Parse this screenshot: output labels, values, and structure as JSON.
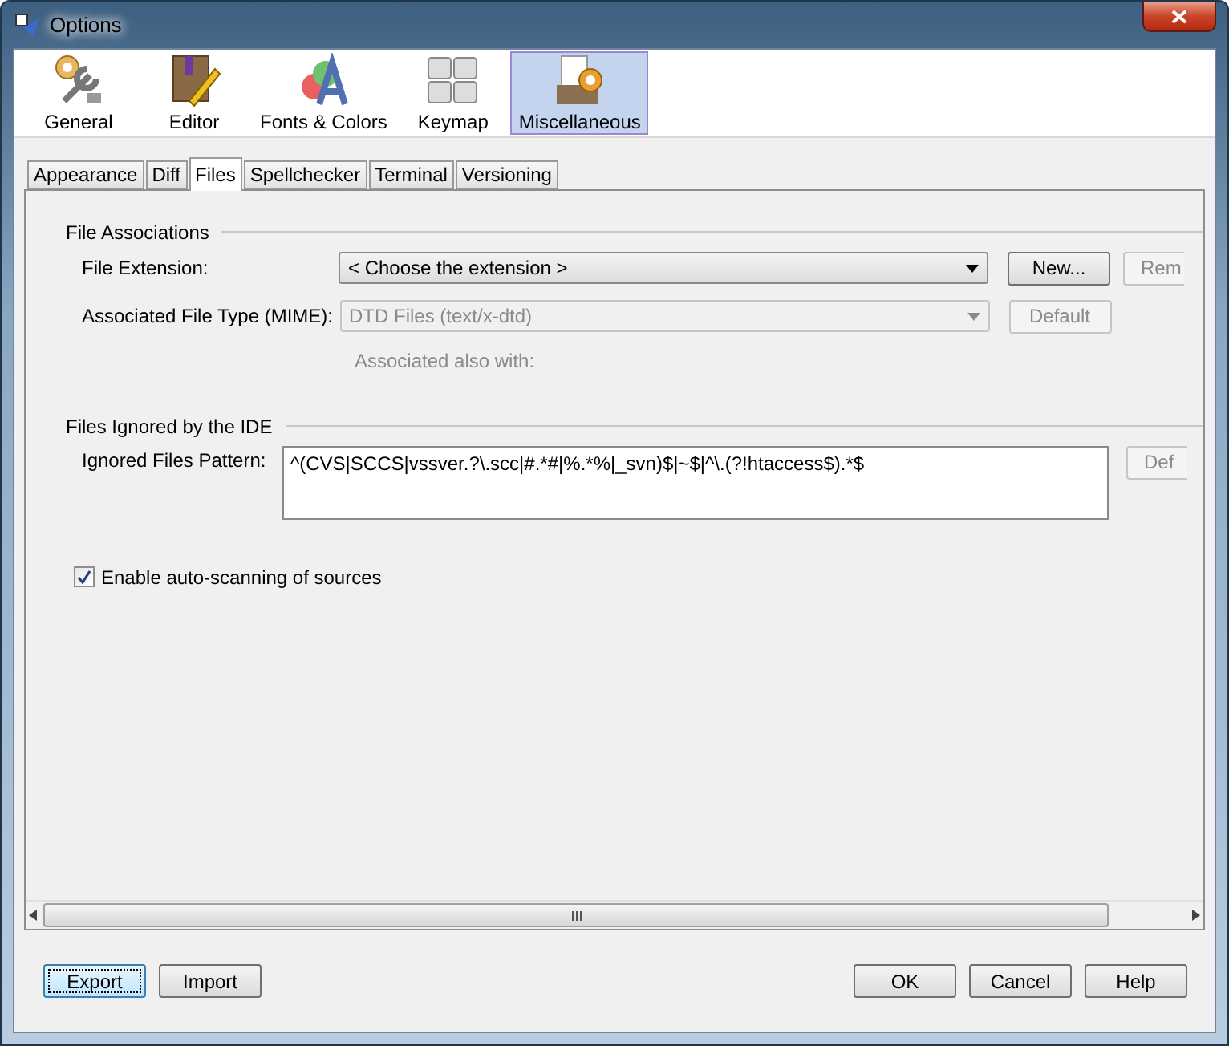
{
  "window": {
    "title": "Options"
  },
  "categories": [
    {
      "label": "General",
      "selected": false
    },
    {
      "label": "Editor",
      "selected": false
    },
    {
      "label": "Fonts & Colors",
      "selected": false
    },
    {
      "label": "Keymap",
      "selected": false
    },
    {
      "label": "Miscellaneous",
      "selected": true
    }
  ],
  "tabs": [
    {
      "label": "Appearance",
      "selected": false
    },
    {
      "label": "Diff",
      "selected": false
    },
    {
      "label": "Files",
      "selected": true
    },
    {
      "label": "Spellchecker",
      "selected": false
    },
    {
      "label": "Terminal",
      "selected": false
    },
    {
      "label": "Versioning",
      "selected": false
    }
  ],
  "file_associations": {
    "heading": "File Associations",
    "file_extension": {
      "label": "File Extension:",
      "value": "< Choose the extension >",
      "disabled": false
    },
    "new_button": {
      "label": "New...",
      "disabled": false
    },
    "remove_button": {
      "label": "Rem",
      "disabled": true
    },
    "mime": {
      "label": "Associated File Type (MIME):",
      "value": "DTD Files (text/x-dtd)",
      "disabled": true
    },
    "default_button": {
      "label": "Default",
      "disabled": true
    },
    "also_with": "Associated also with:"
  },
  "files_ignored": {
    "heading": "Files Ignored by the IDE",
    "label": "Ignored Files Pattern:",
    "value": "^(CVS|SCCS|vssver.?\\.scc|#.*#|%.*%|_svn)$|~$|^\\.(?!htaccess$).*$",
    "default_button": {
      "label": "Def",
      "disabled": true
    }
  },
  "auto_scan": {
    "label": "Enable auto-scanning of sources",
    "checked": true
  },
  "left_buttons": [
    {
      "label": "Export",
      "focused": true
    },
    {
      "label": "Import",
      "focused": false
    }
  ],
  "right_buttons": [
    {
      "label": "OK",
      "focused": false
    },
    {
      "label": "Cancel",
      "focused": false
    },
    {
      "label": "Help",
      "focused": false
    }
  ]
}
